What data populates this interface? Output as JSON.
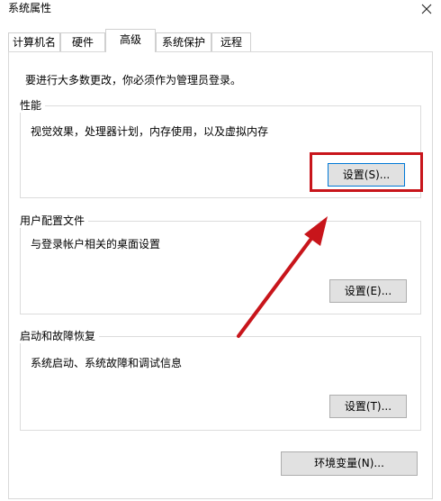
{
  "window": {
    "title": "系统属性",
    "close_icon": "×"
  },
  "tabs": [
    {
      "label": "计算机名",
      "active": false
    },
    {
      "label": "硬件",
      "active": false
    },
    {
      "label": "高级",
      "active": true
    },
    {
      "label": "系统保护",
      "active": false
    },
    {
      "label": "远程",
      "active": false
    }
  ],
  "admin_note": "要进行大多数更改，你必须作为管理员登录。",
  "performance": {
    "title": "性能",
    "description": "视觉效果，处理器计划，内存使用，以及虚拟内存",
    "button_label": "设置(S)..."
  },
  "user_profiles": {
    "title": "用户配置文件",
    "description": "与登录帐户相关的桌面设置",
    "button_label": "设置(E)..."
  },
  "startup_recovery": {
    "title": "启动和故障恢复",
    "description": "系统启动、系统故障和调试信息",
    "button_label": "设置(T)..."
  },
  "env_button_label": "环境变量(N)...",
  "colors": {
    "highlight": "#c8151b",
    "arrow": "#c8151b",
    "focus_border": "#0078d7",
    "button_face": "#e1e1e1"
  }
}
